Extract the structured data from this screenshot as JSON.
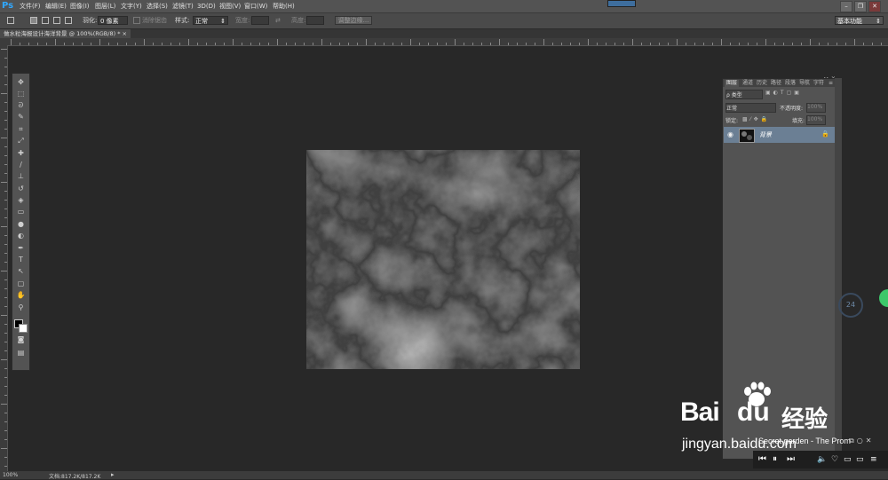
{
  "app": {
    "logo": "Ps"
  },
  "menu": [
    "文件(F)",
    "编辑(E)",
    "图像(I)",
    "图层(L)",
    "文字(Y)",
    "选择(S)",
    "滤镜(T)",
    "3D(D)",
    "视图(V)",
    "窗口(W)",
    "帮助(H)"
  ],
  "window_controls": [
    "–",
    "❐",
    "✕"
  ],
  "options": {
    "feather_label": "羽化:",
    "feather_value": "0 像素",
    "antialias": "消除锯齿",
    "style_label": "样式:",
    "style_value": "正常",
    "width_label": "宽度:",
    "height_label": "高度:",
    "refine_edge": "调整边缘...",
    "workspace": "基本功能"
  },
  "document_tab": "做水粒海报设计海洋背景 @ 100%(RGB/8) *",
  "layers_panel": {
    "tabs": [
      "图层",
      "通道",
      "历史",
      "路径",
      "段落",
      "导航",
      "字符"
    ],
    "kind_label": "ρ 类型",
    "blend_mode": "正常",
    "opacity_label": "不透明度:",
    "opacity_value": "100%",
    "lock_label": "锁定:",
    "fill_label": "填充:",
    "fill_value": "100%",
    "layer_name": "背景"
  },
  "status": {
    "zoom": "100%",
    "doc_info": "文档:817.2K/817.2K"
  },
  "watermark": {
    "brand": "Bai",
    "brand2": "du",
    "cn": "经验",
    "url": "jingyan.baidu.com"
  },
  "player": {
    "title": "Secret garden - The Prom"
  },
  "side_widget": {
    "value": "24"
  },
  "icons": [
    "marquee-icon",
    "lasso-icon",
    "quick-select-icon",
    "crop-icon",
    "eyedropper-icon",
    "healing-icon",
    "brush-icon",
    "stamp-icon",
    "history-brush-icon",
    "eraser-icon",
    "gradient-icon",
    "blur-icon",
    "dodge-icon",
    "pen-icon",
    "type-icon",
    "path-select-icon",
    "shape-icon",
    "hand-icon",
    "zoom-icon",
    "eye-icon",
    "lock-icon"
  ]
}
